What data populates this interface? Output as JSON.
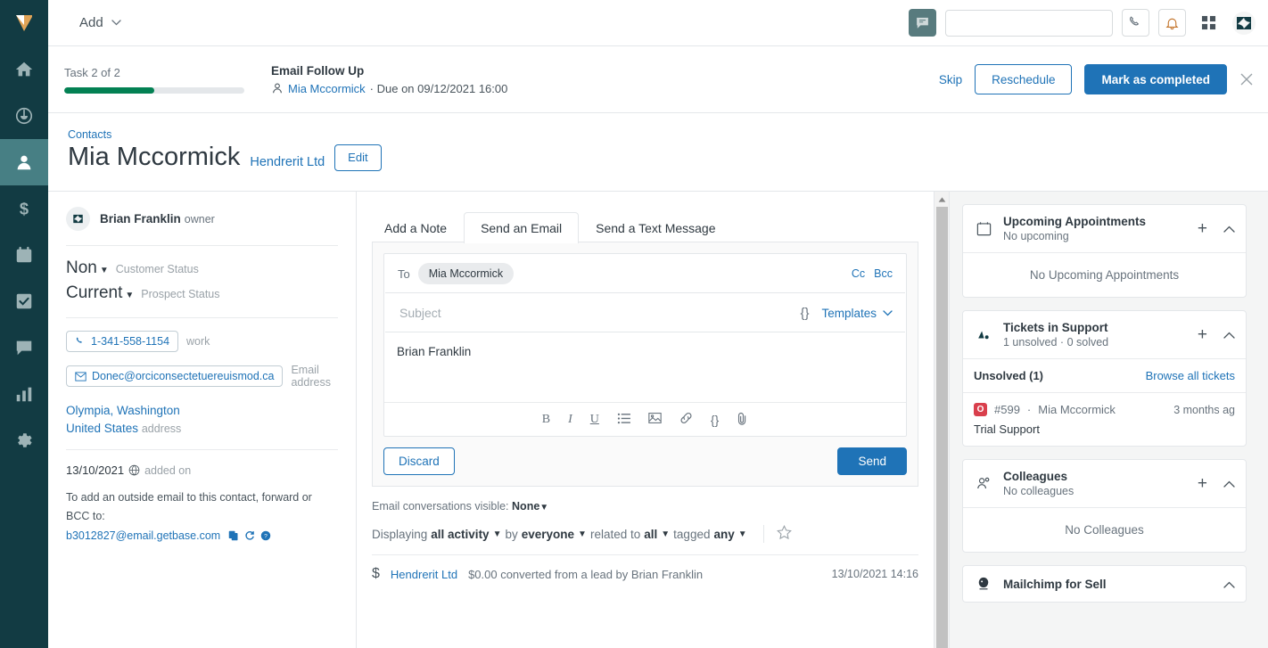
{
  "colors": {
    "nav_bg": "#123b43",
    "nav_active": "#477f84",
    "accent_blue": "#1f73b7",
    "progress_green": "#038153",
    "badge_red": "#d93f4c",
    "chat_button": "#587b7e"
  },
  "leftnav": {
    "logo": "zendesk-sell-logo",
    "items": [
      {
        "name": "home",
        "icon": "home-icon",
        "active": false
      },
      {
        "name": "leads",
        "icon": "lead-icon",
        "active": false
      },
      {
        "name": "contacts",
        "icon": "person-icon",
        "active": true
      },
      {
        "name": "deals",
        "icon": "dollar-icon",
        "active": false
      },
      {
        "name": "calendar",
        "icon": "calendar-icon",
        "active": false
      },
      {
        "name": "tasks",
        "icon": "checkbox-icon",
        "active": false
      },
      {
        "name": "communication",
        "icon": "chat-icon",
        "active": false
      },
      {
        "name": "reports",
        "icon": "bar-chart-icon",
        "active": false
      },
      {
        "name": "settings",
        "icon": "gear-icon",
        "active": false
      }
    ]
  },
  "topbar": {
    "add_label": "Add",
    "search_placeholder": "",
    "search_value": "",
    "icons": [
      "chat-icon",
      "search-icon",
      "phone-icon",
      "bell-icon",
      "apps-grid-icon",
      "zendesk-logo"
    ]
  },
  "task": {
    "count_label": "Task 2 of 2",
    "progress_percent": 50,
    "title": "Email Follow Up",
    "contact": "Mia Mccormick",
    "due": "· Due on 09/12/2021 16:00",
    "skip_label": "Skip",
    "reschedule_label": "Reschedule",
    "complete_label": "Mark as completed",
    "close_icon": "close-icon"
  },
  "contact_header": {
    "breadcrumb": "Contacts",
    "name": "Mia Mccormick",
    "company": "Hendrerit Ltd",
    "edit_label": "Edit"
  },
  "left_panel": {
    "owner_name": "Brian Franklin",
    "owner_role": "owner",
    "customer_status_value": "Non",
    "customer_status_label": "Customer Status",
    "prospect_status_value": "Current",
    "prospect_status_label": "Prospect Status",
    "phone": "1-341-558-1154",
    "phone_label": "work",
    "email": "Donec@orciconsectetuereuismod.ca",
    "email_label": "Email address",
    "address_line1": "Olympia, Washington",
    "address_line2": "United States",
    "address_label": "address",
    "added_date": "13/10/2021",
    "added_label": "added on",
    "bcc_note": "To add an outside email to this contact, forward or BCC to:",
    "bcc_email": "b3012827@email.getbase.com"
  },
  "compose": {
    "tabs": [
      {
        "label": "Add a Note",
        "active": false
      },
      {
        "label": "Send an Email",
        "active": true
      },
      {
        "label": "Send a Text Message",
        "active": false
      }
    ],
    "to_label": "To",
    "to_chip": "Mia Mccormick",
    "cc_label": "Cc",
    "bcc_label": "Bcc",
    "subject_value": "",
    "subject_placeholder": "Subject",
    "brace_icon": "{}",
    "templates_label": "Templates",
    "body_text": "Brian Franklin",
    "toolbar_icons": [
      "bold-icon",
      "italic-icon",
      "underline-icon",
      "bullet-list-icon",
      "image-icon",
      "link-icon",
      "variable-icon",
      "attachment-icon"
    ],
    "discard_label": "Discard",
    "send_label": "Send"
  },
  "activity": {
    "conversations_prefix": "Email conversations visible:",
    "conversations_value": "None",
    "displaying_prefix": "Displaying",
    "filter_activity": "all activity",
    "by_prefix": "by",
    "filter_by": "everyone",
    "related_prefix": "related to",
    "filter_related": "all",
    "tagged_prefix": "tagged",
    "filter_tagged": "any",
    "star_icon": "star-icon",
    "rows": [
      {
        "icon": "dollar-icon",
        "link": "Hendrerit Ltd",
        "text": "$0.00 converted from a lead by Brian Franklin",
        "timestamp": "13/10/2021 14:16"
      }
    ]
  },
  "right_panels": [
    {
      "icon": "calendar-icon",
      "title": "Upcoming Appointments",
      "subtitle": "No upcoming",
      "add": "+",
      "collapse": "chevron-up-icon",
      "empty_text": "No Upcoming Appointments"
    },
    {
      "icon": "support-icon",
      "title": "Tickets in Support",
      "subtitle": "1 unsolved · 0 solved",
      "add": "+",
      "collapse": "chevron-up-icon",
      "section_label": "Unsolved (1)",
      "browse_label": "Browse all tickets",
      "ticket": {
        "badge": "O",
        "id": "#599",
        "requester": "Mia Mccormick",
        "ago": "3 months ag",
        "subject": "Trial Support"
      }
    },
    {
      "icon": "people-icon",
      "title": "Colleagues",
      "subtitle": "No colleagues",
      "add": "+",
      "collapse": "chevron-up-icon",
      "empty_text": "No Colleagues"
    },
    {
      "icon": "mailchimp-icon",
      "title": "Mailchimp for Sell",
      "collapse": "chevron-up-icon"
    }
  ]
}
